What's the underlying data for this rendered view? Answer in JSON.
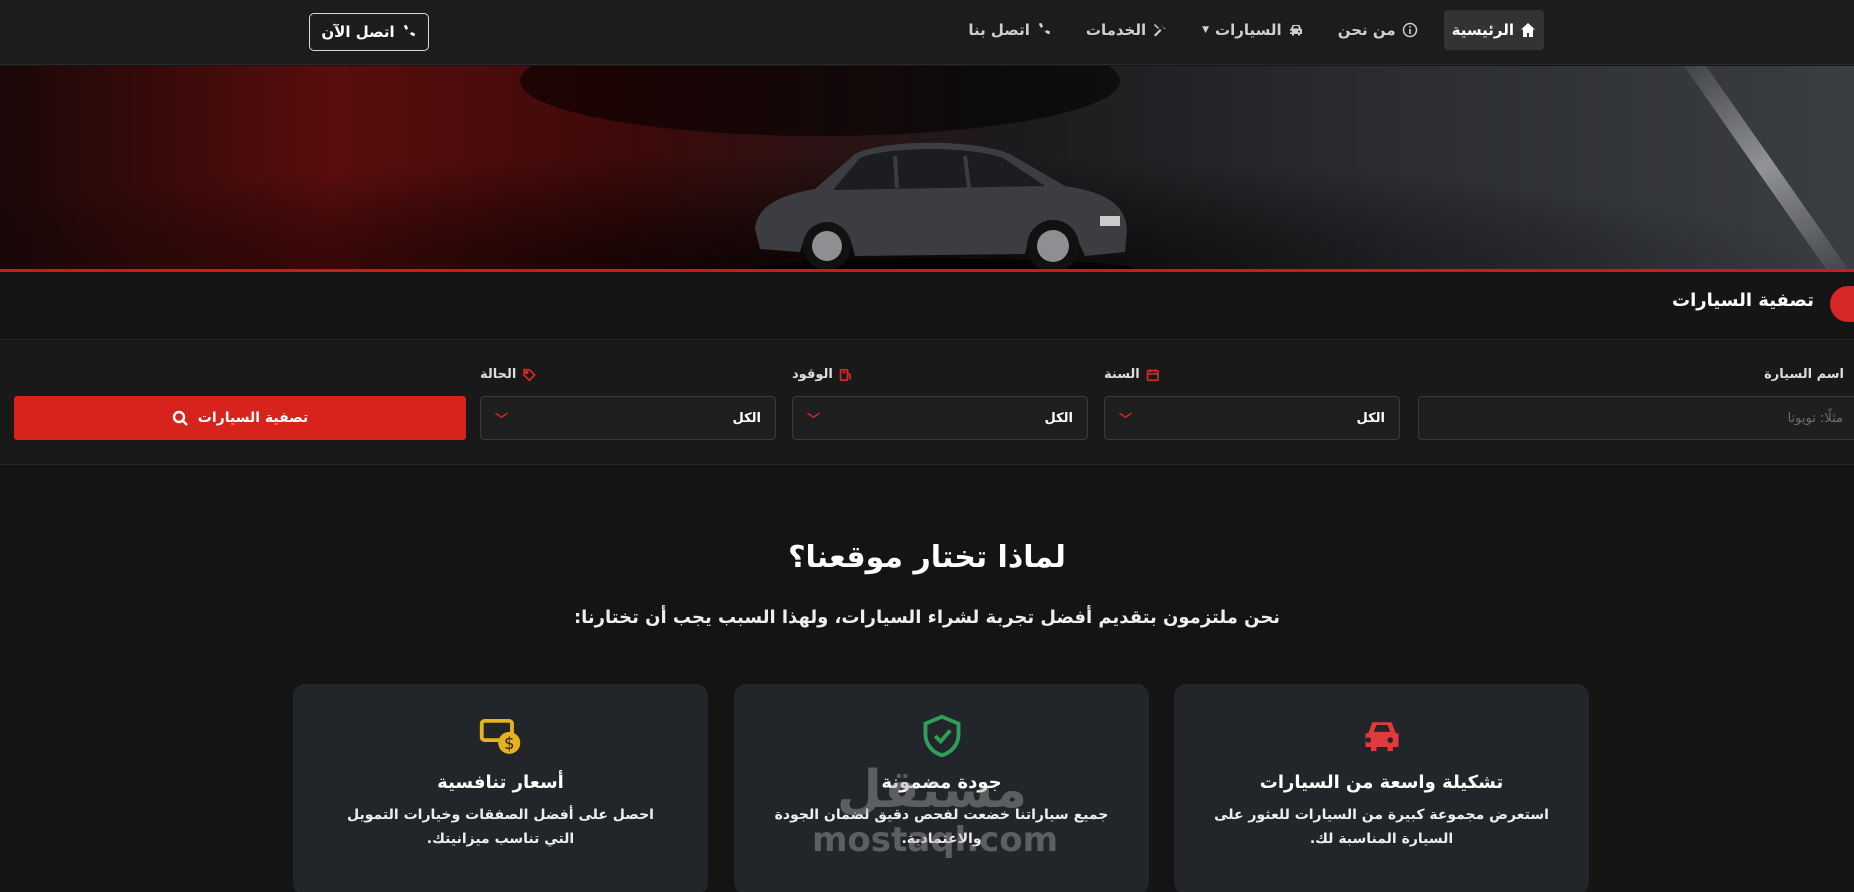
{
  "nav": {
    "items": [
      {
        "label": "الرئيسية",
        "icon": "home-icon",
        "active": true
      },
      {
        "label": "من نحن",
        "icon": "info-icon",
        "active": false
      },
      {
        "label": "السيارات",
        "icon": "car-icon",
        "active": false,
        "dropdown": true
      },
      {
        "label": "الخدمات",
        "icon": "tools-icon",
        "active": false
      },
      {
        "label": "اتصل بنا",
        "icon": "phone-icon",
        "active": false
      }
    ],
    "cta_label": "اتصل الآن"
  },
  "filter": {
    "title": "تصفية السيارات",
    "fields": {
      "name": {
        "label": "اسم السيارة",
        "placeholder": "مثلًا: تويوتا"
      },
      "year": {
        "label": "السنة",
        "value": "الكل"
      },
      "fuel": {
        "label": "الوقود",
        "value": "الكل"
      },
      "condition": {
        "label": "الحالة",
        "value": "الكل"
      }
    },
    "submit_label": "تصفية السيارات"
  },
  "why": {
    "title": "لماذا تختار موقعنا؟",
    "subtitle": "نحن ملتزمون بتقديم أفضل تجربة لشراء السيارات، ولهذا السبب يجب أن تختارنا:",
    "cards": [
      {
        "title": "تشكيلة واسعة من السيارات",
        "text": "استعرض مجموعة كبيرة من السيارات للعثور على السيارة المناسبة لك.",
        "icon": "car-icon",
        "icon_color": "#e03a3a"
      },
      {
        "title": "جودة مضمونة",
        "text": "جميع سياراتنا خضعت لفحص دقيق لضمان الجودة والاعتمادية.",
        "icon": "shield-check-icon",
        "icon_color": "#2f9e5a"
      },
      {
        "title": "أسعار تنافسية",
        "text": "احصل على أفضل الصفقات وخيارات التمويل التي تناسب ميزانيتك.",
        "icon": "money-icon",
        "icon_color": "#e8b21c"
      }
    ]
  },
  "watermark": {
    "arabic": "مستقل",
    "latin": "mostaql.com"
  },
  "colors": {
    "accent": "#d8231d",
    "background": "#141414",
    "card": "#22252a"
  }
}
